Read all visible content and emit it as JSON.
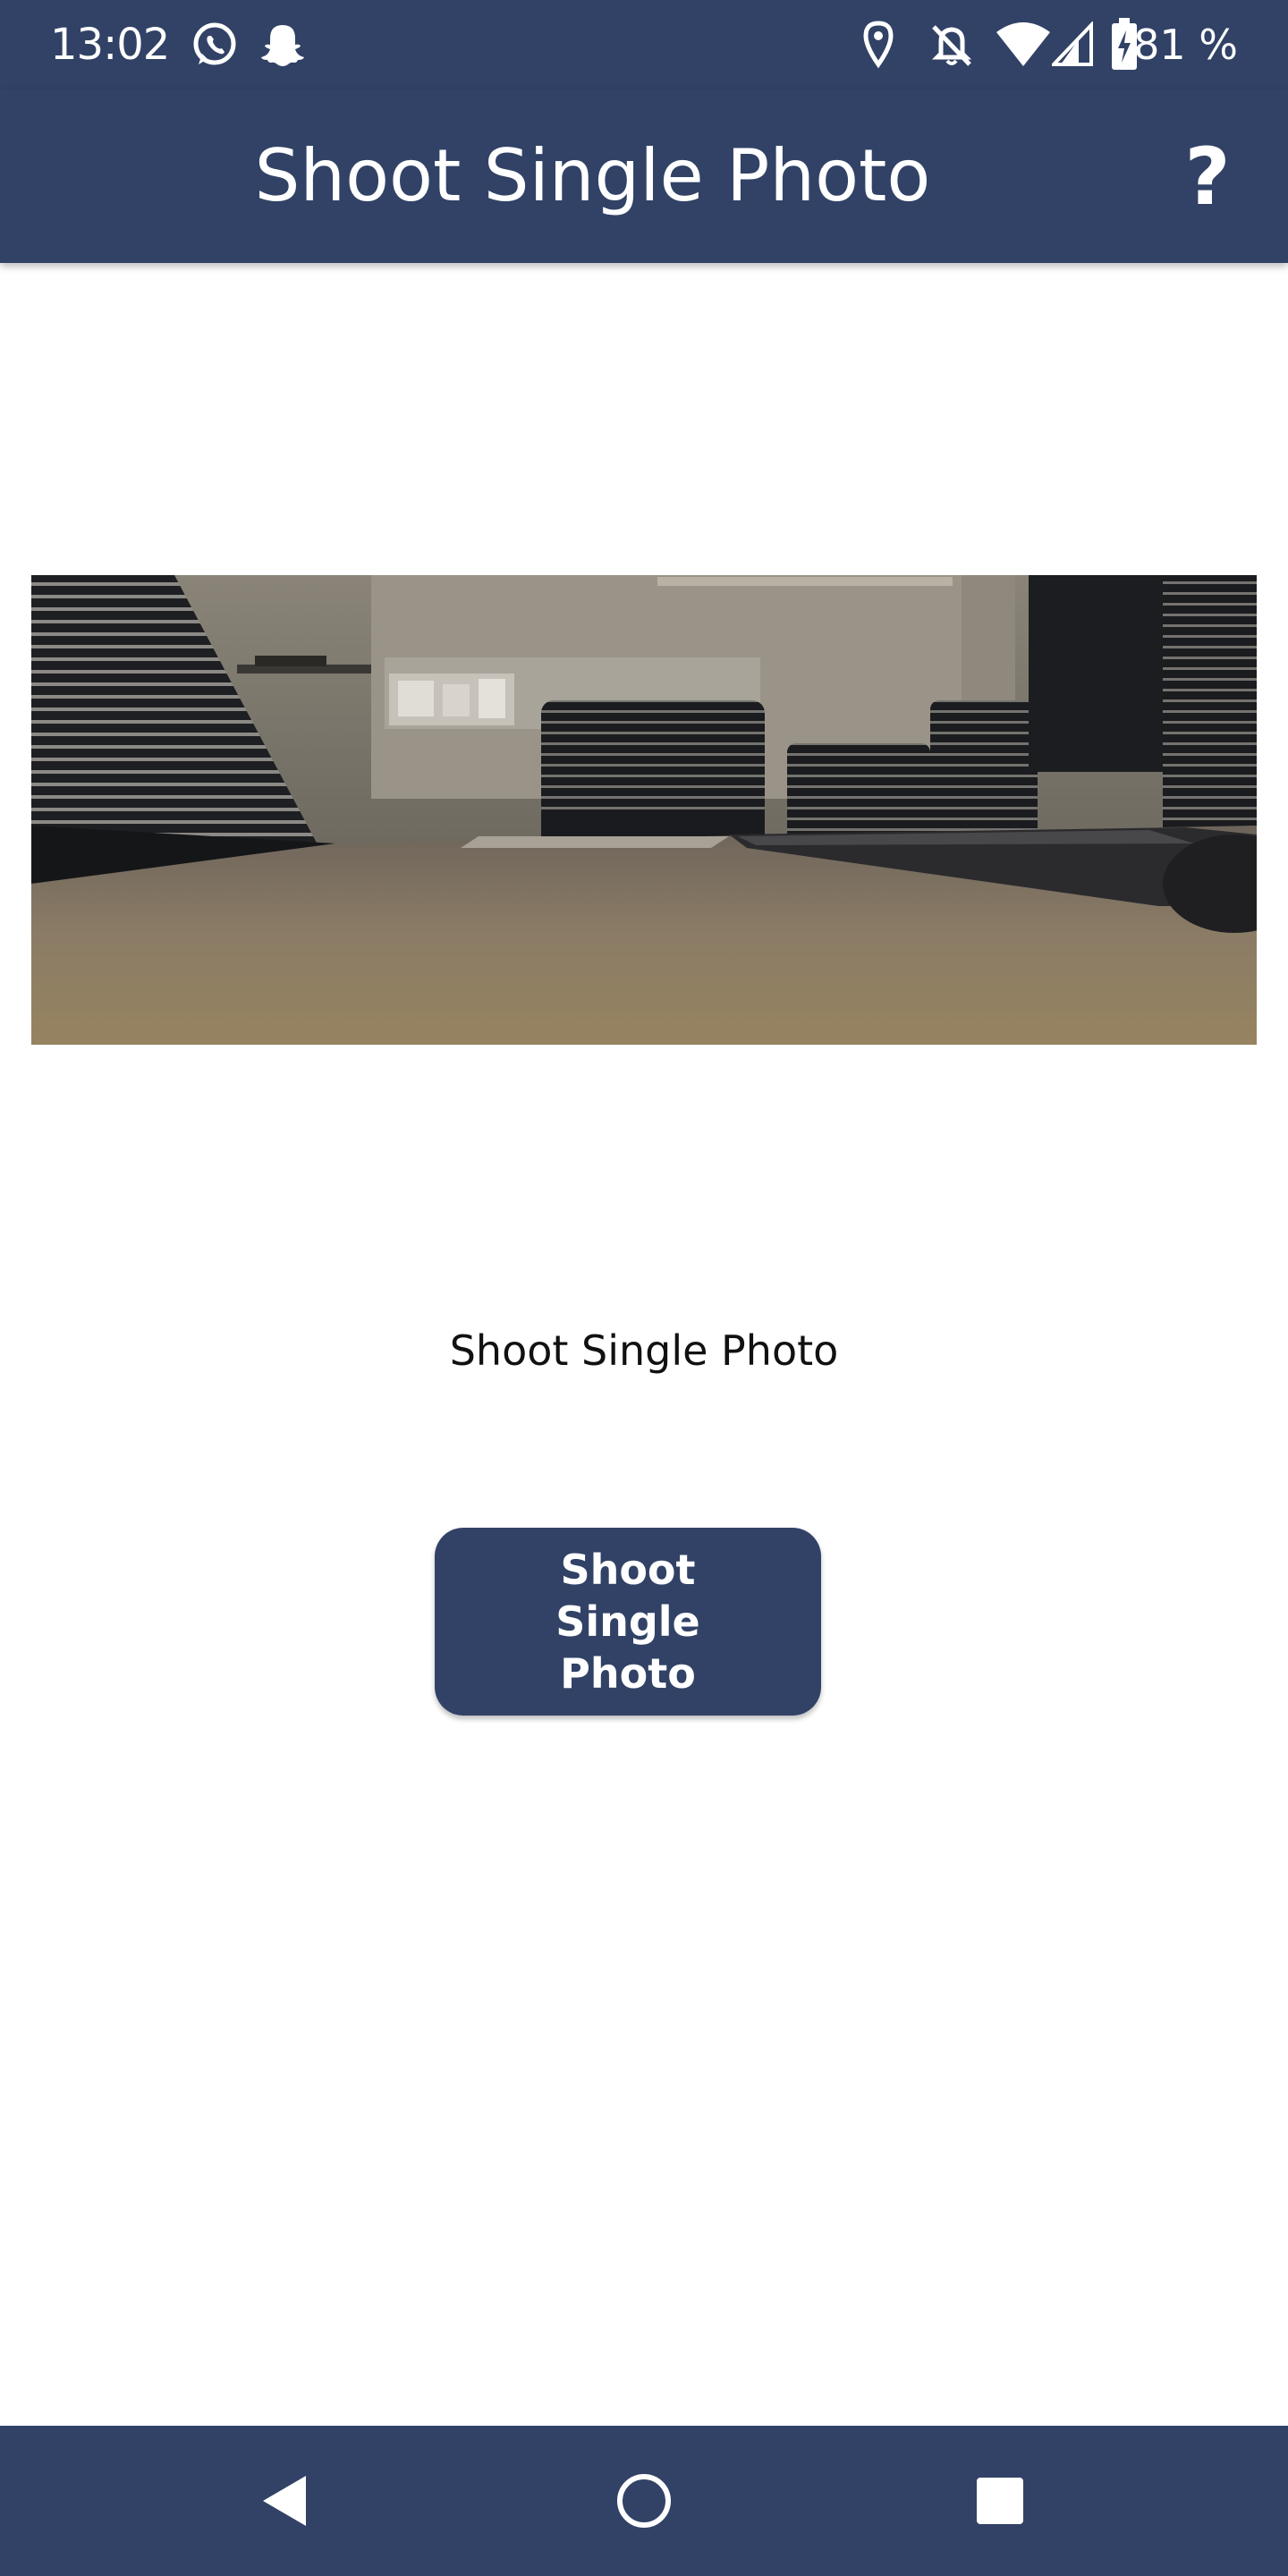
{
  "status_bar": {
    "time": "13:02",
    "battery_percent": "81 %",
    "icons": [
      "whatsapp-icon",
      "snapchat-icon",
      "location-icon",
      "notifications-off-icon",
      "wifi-icon",
      "cellular-signal-icon",
      "battery-charging-icon"
    ]
  },
  "app_bar": {
    "title": "Shoot Single Photo",
    "help_icon": "help-icon",
    "help_label": "?"
  },
  "preview": {
    "description_icon": "camera-preview-image"
  },
  "main": {
    "status_label": "Shoot Single Photo",
    "shoot_button_label": "Shoot Single Photo"
  },
  "nav_bar": {
    "icons": [
      "back-icon",
      "home-icon",
      "recents-icon"
    ]
  },
  "colors": {
    "primary": "#314266",
    "background": "#ffffff",
    "on_primary": "#ffffff"
  }
}
